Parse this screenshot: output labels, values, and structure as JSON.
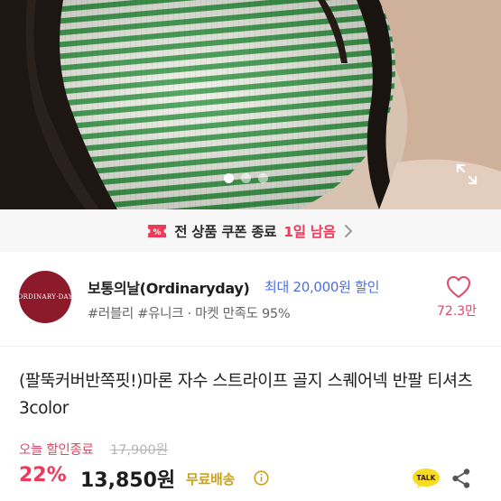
{
  "coupon": {
    "text": "전 상품 쿠폰 종료",
    "days_left": "1일 남음"
  },
  "carousel": {
    "total": 3,
    "active": 1
  },
  "shop": {
    "logo_text": "ORDINARY·DAY",
    "name": "보통의날(Ordinaryday)",
    "max_discount": "최대 20,000원 할인",
    "tags": "#러블리 #유니크 · 마켓 만족도 95%",
    "likes": "72.3만"
  },
  "product": {
    "title": "(팔뚝커버반쪽핏!)마론 자수 스트라이프 골지 스퀘어넥 반팔 티셔츠 3color",
    "sale_label": "오늘 할인종료",
    "original_price": "17,900원",
    "discount_percent": "22%",
    "price": "13,850원",
    "shipping": "무료배송"
  },
  "icons": {
    "coupon": "coupon-icon",
    "expand": "expand-icon",
    "heart": "heart-icon",
    "info": "info-icon",
    "talk": "kakaotalk-icon",
    "share": "share-icon"
  },
  "colors": {
    "accent_pink": "#ec3b5a",
    "discount_blue": "#4b6fe0",
    "shipping_gold": "#c9a11d",
    "shop_logo_bg": "#8c1a2a",
    "stripe_green": "#3a9a4a"
  }
}
